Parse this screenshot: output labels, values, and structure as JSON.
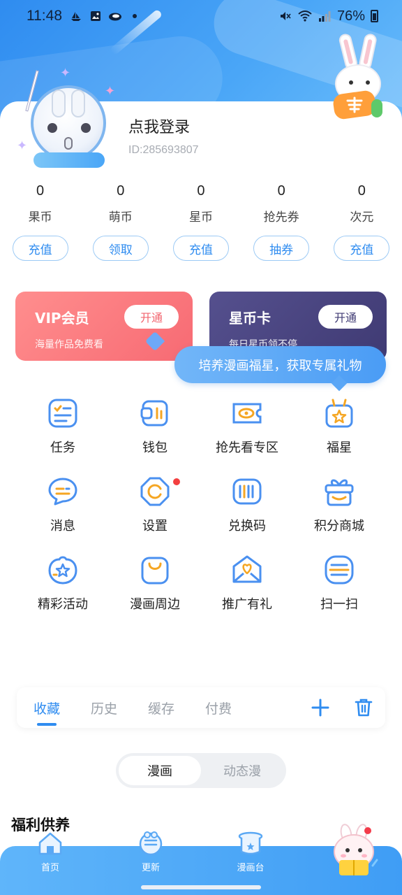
{
  "status_bar": {
    "time": "11:48",
    "battery": "76%",
    "left_icons": [
      "boat-icon",
      "image-icon",
      "cloud-icon",
      "dot-icon"
    ],
    "right_icons": [
      "mute-icon",
      "wifi-icon",
      "signal-icon",
      "battery-icon"
    ]
  },
  "profile": {
    "login_text": "点我登录",
    "user_id": "ID:285693807"
  },
  "stats": [
    {
      "value": "0",
      "label": "果币",
      "action": "充值"
    },
    {
      "value": "0",
      "label": "萌币",
      "action": "领取"
    },
    {
      "value": "0",
      "label": "星币",
      "action": "充值"
    },
    {
      "value": "0",
      "label": "抢先券",
      "action": "抽券"
    },
    {
      "value": "0",
      "label": "次元",
      "action": "充值"
    }
  ],
  "promos": {
    "vip": {
      "title": "VIP会员",
      "subtitle": "海量作品免费看",
      "button": "开通"
    },
    "star": {
      "title": "星币卡",
      "subtitle": "每日星币领不停",
      "button": "开通"
    }
  },
  "tooltip": "培养漫画福星，获取专属礼物",
  "features": [
    {
      "label": "任务",
      "icon": "task-list-icon"
    },
    {
      "label": "钱包",
      "icon": "wallet-icon"
    },
    {
      "label": "抢先看专区",
      "icon": "ticket-eye-icon"
    },
    {
      "label": "福星",
      "icon": "star-bag-icon"
    },
    {
      "label": "消息",
      "icon": "chat-bubble-icon"
    },
    {
      "label": "设置",
      "icon": "settings-icon"
    },
    {
      "label": "兑换码",
      "icon": "barcode-icon"
    },
    {
      "label": "积分商城",
      "icon": "gift-box-icon"
    },
    {
      "label": "精彩活动",
      "icon": "star-badge-icon"
    },
    {
      "label": "漫画周边",
      "icon": "shopping-bag-icon"
    },
    {
      "label": "推广有礼",
      "icon": "heart-envelope-icon"
    },
    {
      "label": "扫一扫",
      "icon": "scan-icon"
    }
  ],
  "library_tabs": [
    "收藏",
    "历史",
    "缓存",
    "付费"
  ],
  "toggle": [
    "漫画",
    "动态漫"
  ],
  "section_title": "福利供养",
  "bottom_nav": [
    {
      "label": "首页",
      "icon": "home-icon"
    },
    {
      "label": "更新",
      "icon": "update-icon"
    },
    {
      "label": "漫画台",
      "icon": "comic-stage-icon"
    }
  ],
  "colors": {
    "accent": "#2f8cf0",
    "vip": "#f76a73",
    "star_card": "#3f3a73",
    "notification": "#f34040"
  }
}
